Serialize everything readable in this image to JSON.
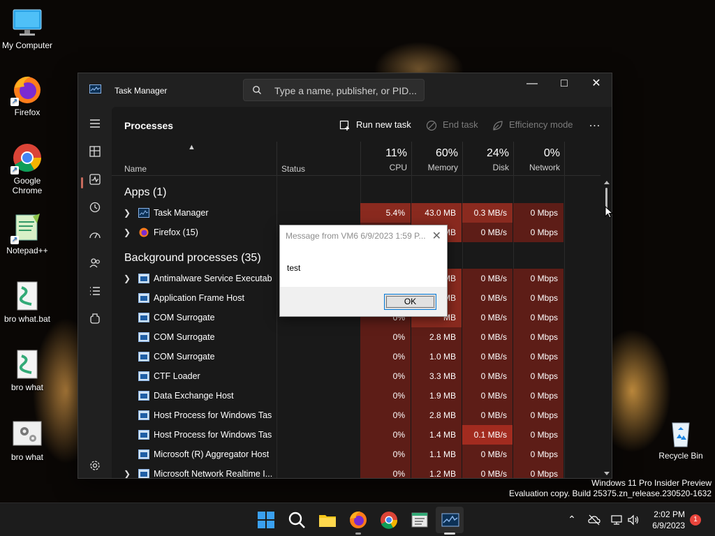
{
  "desktop": {
    "icons": [
      {
        "label": "My Computer"
      },
      {
        "label": "Firefox"
      },
      {
        "label": "Google Chrome"
      },
      {
        "label": "Notepad++"
      },
      {
        "label": "bro what.bat"
      },
      {
        "label": "bro what"
      },
      {
        "label": "bro what"
      },
      {
        "label": "Recycle Bin"
      }
    ],
    "watermark": {
      "line1": "Windows 11 Pro Insider Preview",
      "line2": "Evaluation copy. Build 25375.zn_release.230520-1632"
    }
  },
  "task_manager": {
    "title": "Task Manager",
    "search_placeholder": "Type a name, publisher, or PID...",
    "window_buttons": {
      "minimize": "—",
      "maximize": "□",
      "close": "✕"
    },
    "page_title": "Processes",
    "commands": {
      "run_new_task": "Run new task",
      "end_task": "End task",
      "efficiency_mode": "Efficiency mode",
      "more": "..."
    },
    "columns": {
      "name": "Name",
      "status": "Status",
      "cpu": {
        "pct": "11%",
        "label": "CPU"
      },
      "memory": {
        "pct": "60%",
        "label": "Memory"
      },
      "disk": {
        "pct": "24%",
        "label": "Disk"
      },
      "network": {
        "pct": "0%",
        "label": "Network"
      }
    },
    "sections": {
      "apps": "Apps (1)",
      "background": "Background processes (35)"
    },
    "app_rows": [
      {
        "name": "Task Manager",
        "cpu": "5.4%",
        "memory": "43.0 MB",
        "disk": "0.3 MB/s",
        "network": "0 Mbps"
      },
      {
        "name": "Firefox (15)",
        "cpu": "",
        "memory": "MB",
        "disk": "0 MB/s",
        "network": "0 Mbps"
      }
    ],
    "bg_rows": [
      {
        "name": "Antimalware Service Executable",
        "cpu": "",
        "memory": "MB",
        "disk": "0 MB/s",
        "network": "0 Mbps"
      },
      {
        "name": "Application Frame Host",
        "cpu": "",
        "memory": "MB",
        "disk": "0 MB/s",
        "network": "0 Mbps"
      },
      {
        "name": "COM Surrogate",
        "cpu": "0%",
        "memory": "MB",
        "disk": "0 MB/s",
        "network": "0 Mbps"
      },
      {
        "name": "COM Surrogate",
        "cpu": "0%",
        "memory": "2.8 MB",
        "disk": "0 MB/s",
        "network": "0 Mbps"
      },
      {
        "name": "COM Surrogate",
        "cpu": "0%",
        "memory": "1.0 MB",
        "disk": "0 MB/s",
        "network": "0 Mbps"
      },
      {
        "name": "CTF Loader",
        "cpu": "0%",
        "memory": "3.3 MB",
        "disk": "0 MB/s",
        "network": "0 Mbps"
      },
      {
        "name": "Data Exchange Host",
        "cpu": "0%",
        "memory": "1.9 MB",
        "disk": "0 MB/s",
        "network": "0 Mbps"
      },
      {
        "name": "Host Process for Windows Tasks",
        "cpu": "0%",
        "memory": "2.8 MB",
        "disk": "0 MB/s",
        "network": "0 Mbps"
      },
      {
        "name": "Host Process for Windows Tasks",
        "cpu": "0%",
        "memory": "1.4 MB",
        "disk": "0.1 MB/s",
        "network": "0 Mbps"
      },
      {
        "name": "Microsoft (R) Aggregator Host",
        "cpu": "0%",
        "memory": "1.1 MB",
        "disk": "0 MB/s",
        "network": "0 Mbps"
      },
      {
        "name": "Microsoft Network Realtime I...",
        "cpu": "0%",
        "memory": "1.2 MB",
        "disk": "0 MB/s",
        "network": "0 Mbps"
      }
    ]
  },
  "dialog": {
    "title": "Message from VM6 6/9/2023 1:59 P...",
    "close": "✕",
    "message": "test",
    "ok": "OK"
  },
  "taskbar": {
    "time": "2:02 PM",
    "date": "6/9/2023",
    "notifications": "1"
  },
  "colors": {
    "heat_low": "#5d1d17",
    "heat_mid": "#8a2a1f",
    "heat_high": "#a22b1f",
    "accent_bar": "#c76a5c",
    "win_blue": "#0078d7"
  }
}
